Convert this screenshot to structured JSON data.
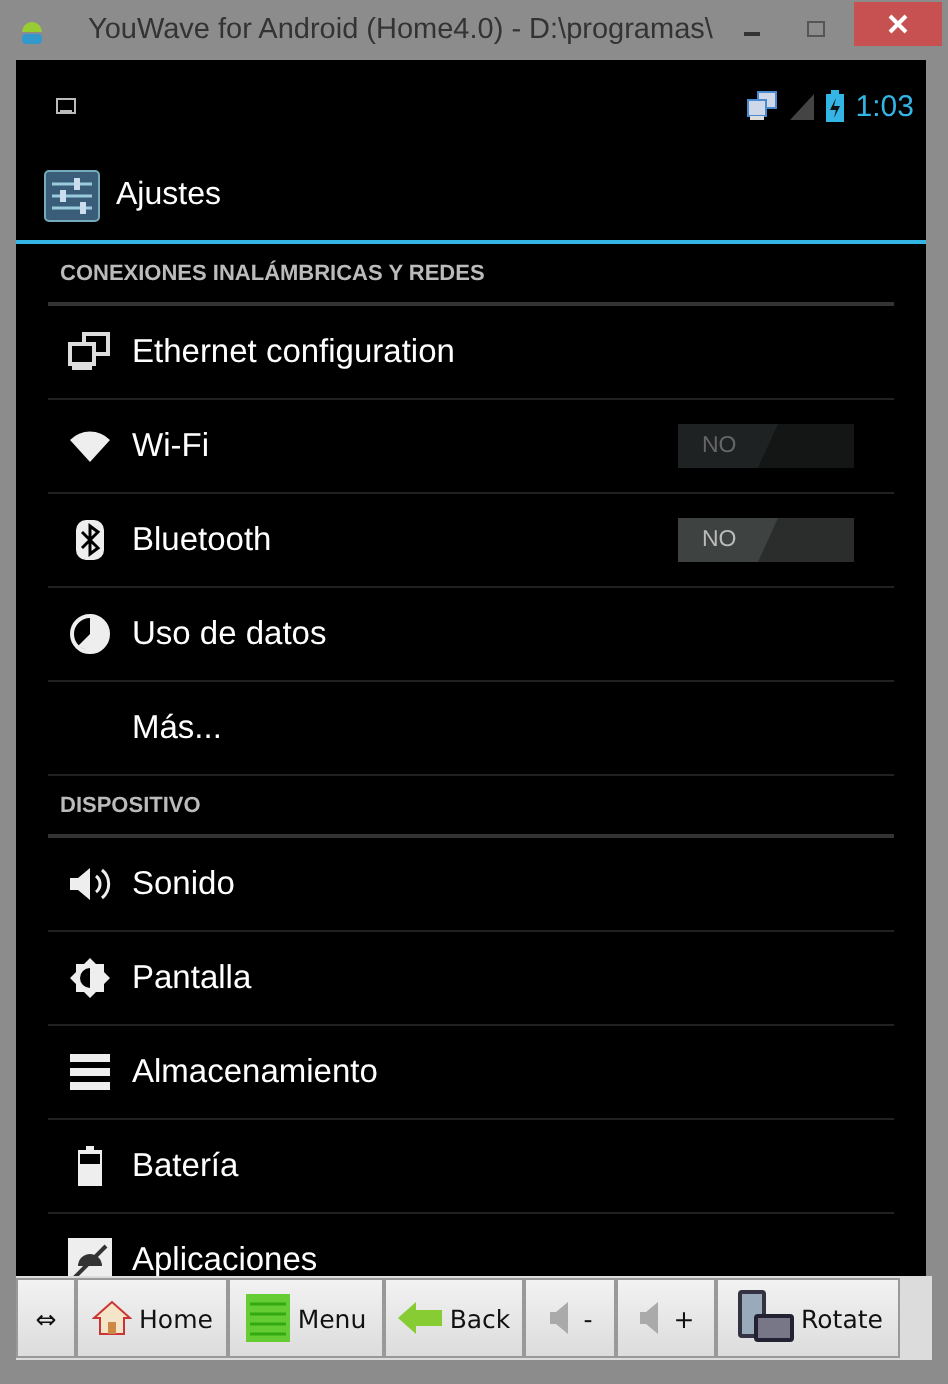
{
  "window": {
    "title": "YouWave for Android (Home4.0) - D:\\programas\\"
  },
  "status_bar": {
    "time": "1:03"
  },
  "action_bar": {
    "title": "Ajustes"
  },
  "sections": [
    {
      "header": "CONEXIONES INALÁMBRICAS Y REDES",
      "items": [
        {
          "label": "Ethernet configuration"
        },
        {
          "label": "Wi-Fi",
          "toggle": {
            "label": "NO",
            "on": false,
            "disabled": true
          }
        },
        {
          "label": "Bluetooth",
          "toggle": {
            "label": "NO",
            "on": false,
            "disabled": false
          }
        },
        {
          "label": "Uso de datos"
        },
        {
          "label": "Más..."
        }
      ]
    },
    {
      "header": "DISPOSITIVO",
      "items": [
        {
          "label": "Sonido"
        },
        {
          "label": "Pantalla"
        },
        {
          "label": "Almacenamiento"
        },
        {
          "label": "Batería"
        },
        {
          "label": "Aplicaciones"
        }
      ]
    }
  ],
  "toolbar": [
    {
      "label": "⇔"
    },
    {
      "label": "Home"
    },
    {
      "label": "Menu"
    },
    {
      "label": "Back"
    },
    {
      "label": "-"
    },
    {
      "label": "+"
    },
    {
      "label": "Rotate"
    }
  ]
}
